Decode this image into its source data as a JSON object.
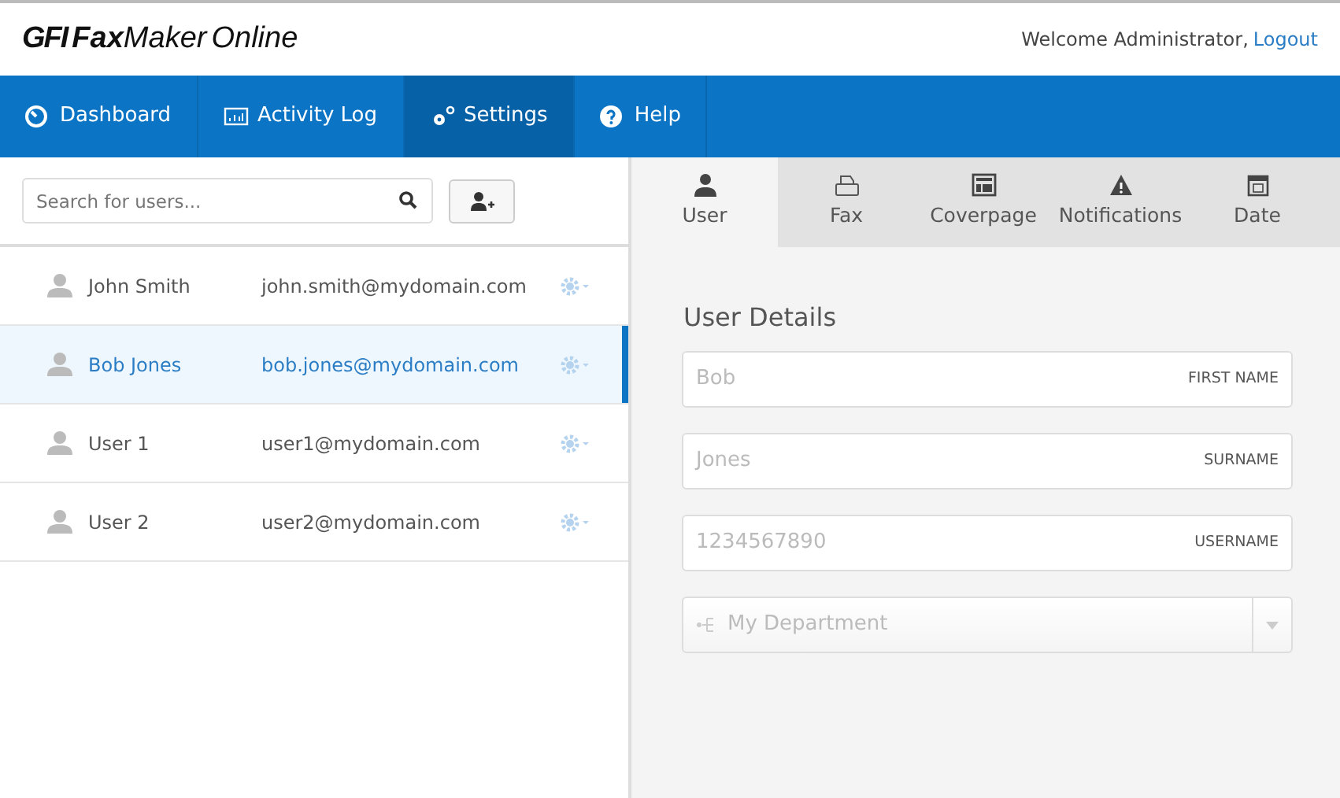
{
  "header": {
    "logo": {
      "brand": "GFI",
      "product": "**Fax**Maker",
      "suffix": "Online"
    },
    "welcome": "Welcome Administrator,",
    "logout": "Logout"
  },
  "nav": [
    {
      "label": "Dashboard",
      "kind": "dashboard",
      "selected": false
    },
    {
      "label": "Activity Log",
      "kind": "log",
      "selected": false
    },
    {
      "label": "Settings",
      "kind": "settings",
      "selected": true
    },
    {
      "label": "Help",
      "kind": "help",
      "selected": false
    }
  ],
  "search": {
    "placeholder": "Search for users..."
  },
  "users": [
    {
      "name": "John Smith",
      "email": "john.smith@mydomain.com",
      "selected": false
    },
    {
      "name": "Bob Jones",
      "email": "bob.jones@mydomain.com",
      "selected": true
    },
    {
      "name": "User 1",
      "email": "user1@mydomain.com",
      "selected": false
    },
    {
      "name": "User 2",
      "email": "user2@mydomain.com",
      "selected": false
    }
  ],
  "tabs": [
    {
      "label": "User",
      "kind": "user",
      "selected": true
    },
    {
      "label": "Fax",
      "kind": "fax",
      "selected": false
    },
    {
      "label": "Coverpage",
      "kind": "coverpage",
      "selected": false
    },
    {
      "label": "Notifications",
      "kind": "notifications",
      "selected": false
    },
    {
      "label": "Date",
      "kind": "date",
      "selected": false
    }
  ],
  "details": {
    "title": "User Details",
    "fields": [
      {
        "kind": "text",
        "value": "Bob",
        "label": "FIRST NAME"
      },
      {
        "kind": "text",
        "value": "Jones",
        "label": "SURNAME"
      },
      {
        "kind": "text",
        "value": "1234567890",
        "label": "USERNAME"
      },
      {
        "kind": "select",
        "value": "My Department"
      }
    ]
  }
}
